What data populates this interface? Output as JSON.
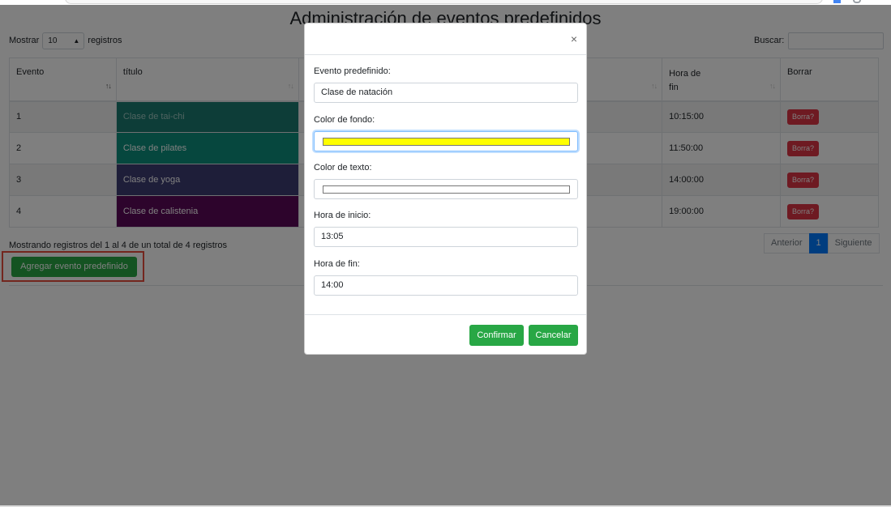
{
  "page": {
    "title": "Administración de eventos predefinidos",
    "show_label": "Mostrar",
    "page_length": "10",
    "records_label": "registros",
    "search_label": "Buscar:",
    "search_value": ""
  },
  "table": {
    "columns": [
      "Evento",
      "título",
      "",
      "Hora de fin",
      "Borrar"
    ],
    "rows": [
      {
        "id": "1",
        "title": "Clase de tai-chi",
        "end": "10:15:00",
        "delete_label": "Borra?",
        "bg": "#1a7a70",
        "fg": "#a0c8c2"
      },
      {
        "id": "2",
        "title": "Clase de pilates",
        "end": "11:50:00",
        "delete_label": "Borra?",
        "bg": "#0d8f7d",
        "fg": "#ffffff"
      },
      {
        "id": "3",
        "title": "Clase de yoga",
        "end": "14:00:00",
        "delete_label": "Borra?",
        "bg": "#3d3c73",
        "fg": "#ffffff"
      },
      {
        "id": "4",
        "title": "Clase de calistenia",
        "end": "19:00:00",
        "delete_label": "Borra?",
        "bg": "#5a0858",
        "fg": "#ffffff"
      }
    ]
  },
  "footer": {
    "info": "Mostrando registros del 1 al 4 de un total de 4 registros",
    "prev": "Anterior",
    "current_page": "1",
    "next": "Siguiente",
    "add_button": "Agregar evento predefinido"
  },
  "modal": {
    "close": "×",
    "fields": [
      {
        "label": "Evento predefinido:",
        "value": "Clase de natación"
      },
      {
        "label": "Color de fondo:",
        "value": "",
        "color": "#ffff00"
      },
      {
        "label": "Color de texto:",
        "value": "",
        "color": "#ffffff"
      },
      {
        "label": "Hora de inicio:",
        "value": "13:05"
      },
      {
        "label": "Hora de fin:",
        "value": "14:00"
      }
    ],
    "confirm": "Confirmar",
    "cancel": "Cancelar"
  },
  "colors": {
    "primary": "#007bff",
    "success": "#28a745",
    "danger": "#dc3545",
    "highlight_outline": "#e74c3c"
  },
  "icons": {
    "sort": "sort-icon",
    "sort_active": "sort-asc-icon",
    "close": "close-icon",
    "caret": "chevron-down-icon"
  }
}
